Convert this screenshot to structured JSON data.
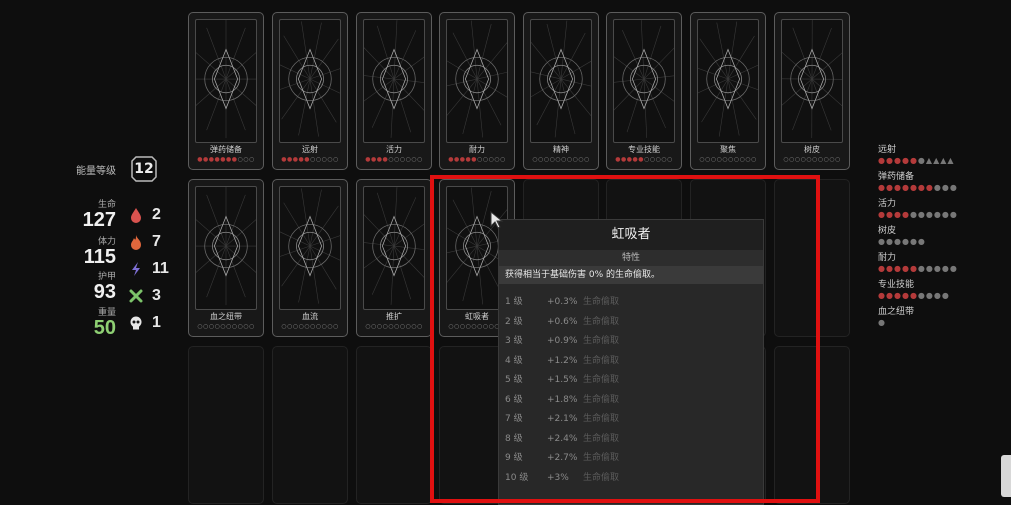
{
  "energy": {
    "label": "能量等级",
    "value": "12"
  },
  "stats": [
    {
      "label": "生命",
      "value": "127"
    },
    {
      "label": "体力",
      "value": "115"
    },
    {
      "label": "护甲",
      "value": "93"
    },
    {
      "label": "重量",
      "value": "50"
    }
  ],
  "resistances": [
    {
      "icon": "blood-drop-icon",
      "value": "2",
      "color": "#d9534f"
    },
    {
      "icon": "fire-icon",
      "value": "7",
      "color": "#e0673c"
    },
    {
      "icon": "lightning-icon",
      "value": "11",
      "color": "#7e6fd6"
    },
    {
      "icon": "crossed-bones-icon",
      "value": "3",
      "color": "#7cc36a"
    },
    {
      "icon": "skull-icon",
      "value": "1",
      "color": "#e6e6e6"
    }
  ],
  "cards_row1": [
    {
      "name": "弹药储备",
      "pips": 10,
      "on": 7
    },
    {
      "name": "远射",
      "pips": 10,
      "on": 5
    },
    {
      "name": "活力",
      "pips": 10,
      "on": 4
    },
    {
      "name": "耐力",
      "pips": 10,
      "on": 5
    },
    {
      "name": "精神",
      "pips": 10,
      "on": 0
    },
    {
      "name": "专业技能",
      "pips": 10,
      "on": 5
    },
    {
      "name": "聚焦",
      "pips": 10,
      "on": 0
    },
    {
      "name": "树皮",
      "pips": 10,
      "on": 0
    }
  ],
  "cards_row2": [
    {
      "name": "血之纽带",
      "pips": 10,
      "on": 0
    },
    {
      "name": "血流",
      "pips": 10,
      "on": 0
    },
    {
      "name": "推扩",
      "pips": 10,
      "on": 0
    },
    {
      "name": "虹吸者",
      "pips": 10,
      "on": 0
    }
  ],
  "right_list": [
    {
      "name": "远射",
      "pips": "●●●●●●▲▲▲▲",
      "on": 5
    },
    {
      "name": "弹药储备",
      "pips": "●●●●●●●●●●",
      "on": 7
    },
    {
      "name": "活力",
      "pips": "●●●●●●●●●●",
      "on": 4
    },
    {
      "name": "树皮",
      "pips": "●●●●●●",
      "on": 0
    },
    {
      "name": "耐力",
      "pips": "●●●●●●●●●●",
      "on": 5
    },
    {
      "name": "专业技能",
      "pips": "●●●●●●●●●",
      "on": 5
    },
    {
      "name": "血之纽带",
      "pips": "●",
      "on": 0
    }
  ],
  "tooltip": {
    "title": "虹吸者",
    "subtitle": "特性",
    "description": "获得相当于基础伤害 0% 的生命偷取。",
    "levels": [
      {
        "level": "1 级",
        "bonus": "+0.3%",
        "effect": "生命偷取"
      },
      {
        "level": "2 级",
        "bonus": "+0.6%",
        "effect": "生命偷取"
      },
      {
        "level": "3 级",
        "bonus": "+0.9%",
        "effect": "生命偷取"
      },
      {
        "level": "4 级",
        "bonus": "+1.2%",
        "effect": "生命偷取"
      },
      {
        "level": "5 级",
        "bonus": "+1.5%",
        "effect": "生命偷取"
      },
      {
        "level": "6 级",
        "bonus": "+1.8%",
        "effect": "生命偷取"
      },
      {
        "level": "7 级",
        "bonus": "+2.1%",
        "effect": "生命偷取"
      },
      {
        "level": "8 级",
        "bonus": "+2.4%",
        "effect": "生命偷取"
      },
      {
        "level": "9 级",
        "bonus": "+2.7%",
        "effect": "生命偷取"
      },
      {
        "level": "10 级",
        "bonus": "+3%",
        "effect": "生命偷取"
      }
    ]
  },
  "colors": {
    "highlight": "#e01010",
    "pip_on": "#b43a3a"
  }
}
